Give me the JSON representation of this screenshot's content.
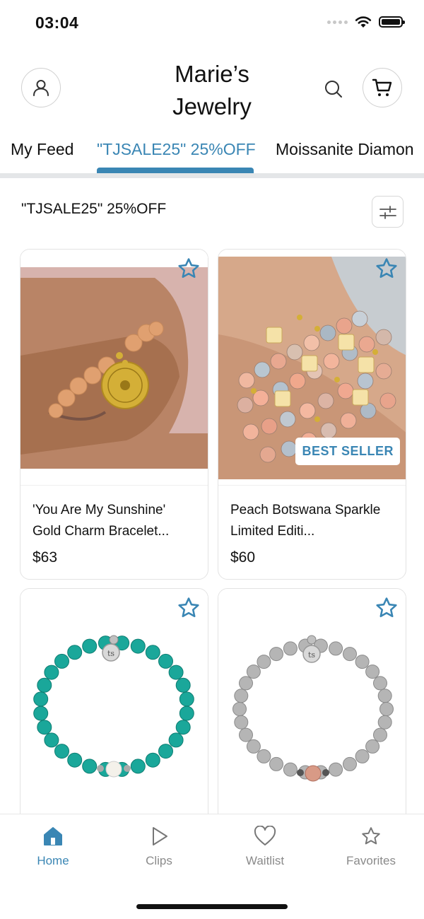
{
  "status_bar": {
    "time": "03:04"
  },
  "header": {
    "title_line1": "Marie’s",
    "title_line2": "Jewelry"
  },
  "tabs": [
    {
      "label": "My Feed",
      "active": false
    },
    {
      "label": "\"TJSALE25\" 25%OFF",
      "active": true
    },
    {
      "label": "Moissanite Diamon",
      "active": false
    }
  ],
  "feed": {
    "title": "\"TJSALE25\" 25%OFF"
  },
  "products": [
    {
      "name": "'You Are My Sunshine' Gold Charm Bracelet...",
      "price": "$63",
      "badge": ""
    },
    {
      "name": "Peach Botswana Sparkle Limited Editi...",
      "price": "$60",
      "badge": "BEST SELLER"
    },
    {
      "name": "",
      "price": "",
      "badge": ""
    },
    {
      "name": "",
      "price": "",
      "badge": ""
    }
  ],
  "bottom_nav": [
    {
      "label": "Home",
      "icon": "home-icon",
      "active": true
    },
    {
      "label": "Clips",
      "icon": "play-icon",
      "active": false
    },
    {
      "label": "Waitlist",
      "icon": "heart-icon",
      "active": false
    },
    {
      "label": "Favorites",
      "icon": "star-icon",
      "active": false
    }
  ],
  "colors": {
    "accent": "#3a86b4",
    "divider": "#e4e6e8",
    "muted": "#8a8a8a"
  }
}
